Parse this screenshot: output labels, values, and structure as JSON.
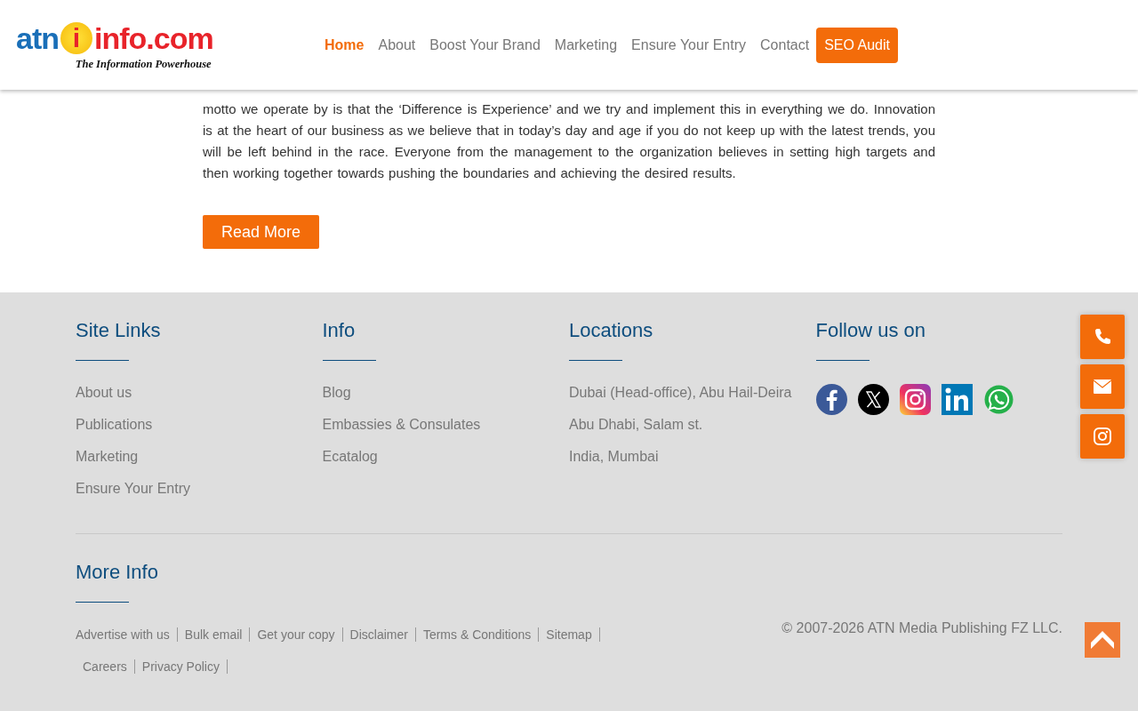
{
  "header": {
    "logo": {
      "part1": "atn",
      "badge": "i",
      "part2": "info.com",
      "tagline": "The Information Powerhouse"
    },
    "nav": [
      {
        "label": "Home",
        "selected": true
      },
      {
        "label": "About",
        "selected": false
      },
      {
        "label": "Boost Your Brand",
        "selected": false
      },
      {
        "label": "Marketing",
        "selected": false
      },
      {
        "label": "Ensure Your Entry",
        "selected": false
      },
      {
        "label": "Contact",
        "selected": false
      }
    ],
    "cta": "SEO Audit"
  },
  "about": {
    "text": "motto we operate by is that the ‘Difference is Experience’ and we try and implement this in everything we do. Innovation is at the heart of our business as we believe that in today’s day and age if you do not keep up with the latest trends, you will be left behind in the race. Everyone from the management to the organization believes in setting high targets and then working together towards pushing the boundaries and achieving the desired results.",
    "button": "Read More"
  },
  "footer": {
    "columns": [
      {
        "title": "Site Links",
        "links": [
          "About us",
          "Publications",
          "Marketing",
          "Ensure Your Entry"
        ]
      },
      {
        "title": "Info",
        "links": [
          "Blog",
          "Embassies & Consulates",
          "Ecatalog"
        ]
      },
      {
        "title": "Locations",
        "items": [
          "Dubai (Head-office), Abu Hail-Deira",
          "Abu Dhabi, Salam st.",
          "India, Mumbai"
        ]
      },
      {
        "title": "Follow us on",
        "kind": "social"
      }
    ],
    "more_info": {
      "title": "More Info",
      "links": [
        "Advertise with us",
        "Bulk email",
        "Get your copy",
        "Disclaimer",
        "Terms & Conditions",
        "Sitemap",
        "Careers",
        "Privacy Policy"
      ]
    },
    "copyright": "© 2007-2026 ATN Media Publishing FZ LLC."
  }
}
